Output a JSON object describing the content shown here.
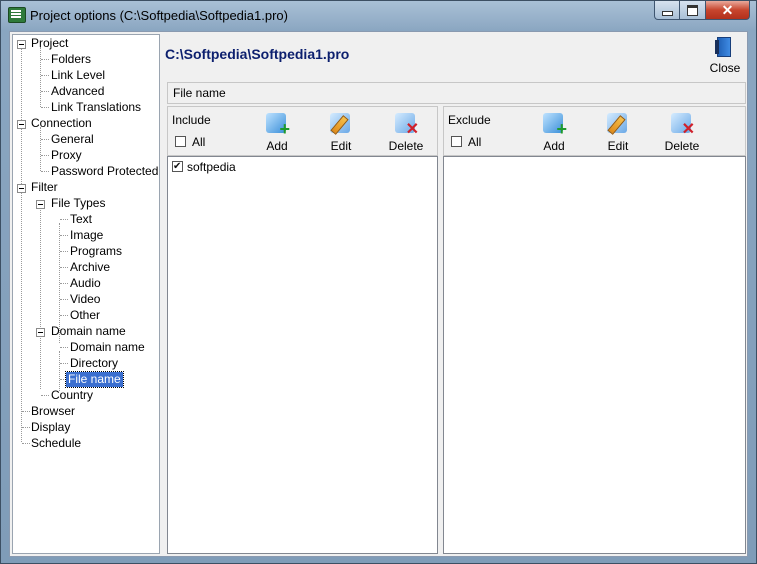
{
  "window": {
    "title": "Project options (C:\\Softpedia\\Softpedia1.pro)",
    "caption_min": "‒",
    "caption_max": "□",
    "caption_close": "✕"
  },
  "tree": {
    "items": [
      {
        "label": "Project",
        "expanded": true
      },
      {
        "label": "Folders"
      },
      {
        "label": "Link Level"
      },
      {
        "label": "Advanced"
      },
      {
        "label": "Link Translations"
      },
      {
        "label": "Connection",
        "expanded": true
      },
      {
        "label": "General"
      },
      {
        "label": "Proxy"
      },
      {
        "label": "Password Protected"
      },
      {
        "label": "Filter",
        "expanded": true
      },
      {
        "label": "File Types",
        "expanded": true
      },
      {
        "label": "Text"
      },
      {
        "label": "Image"
      },
      {
        "label": "Programs"
      },
      {
        "label": "Archive"
      },
      {
        "label": "Audio"
      },
      {
        "label": "Video"
      },
      {
        "label": "Other"
      },
      {
        "label": "Domain name",
        "expanded": true
      },
      {
        "label": "Domain name"
      },
      {
        "label": "Directory"
      },
      {
        "label": "File name",
        "selected": true
      },
      {
        "label": "Country"
      },
      {
        "label": "Browser"
      },
      {
        "label": "Display"
      },
      {
        "label": "Schedule"
      }
    ]
  },
  "header": {
    "path": "C:\\Softpedia\\Softpedia1.pro",
    "close_label": "Close"
  },
  "section": {
    "title": "File name"
  },
  "include": {
    "title": "Include",
    "all_label": "All",
    "all_checked": false,
    "add_label": "Add",
    "edit_label": "Edit",
    "delete_label": "Delete",
    "items": [
      {
        "label": "softpedia",
        "checked": true
      }
    ]
  },
  "exclude": {
    "title": "Exclude",
    "all_label": "All",
    "all_checked": false,
    "add_label": "Add",
    "edit_label": "Edit",
    "delete_label": "Delete",
    "items": []
  },
  "colors": {
    "path_text": "#0c1f6e",
    "selection": "#3b6fd0",
    "titlebar": "#a9c0d6"
  }
}
